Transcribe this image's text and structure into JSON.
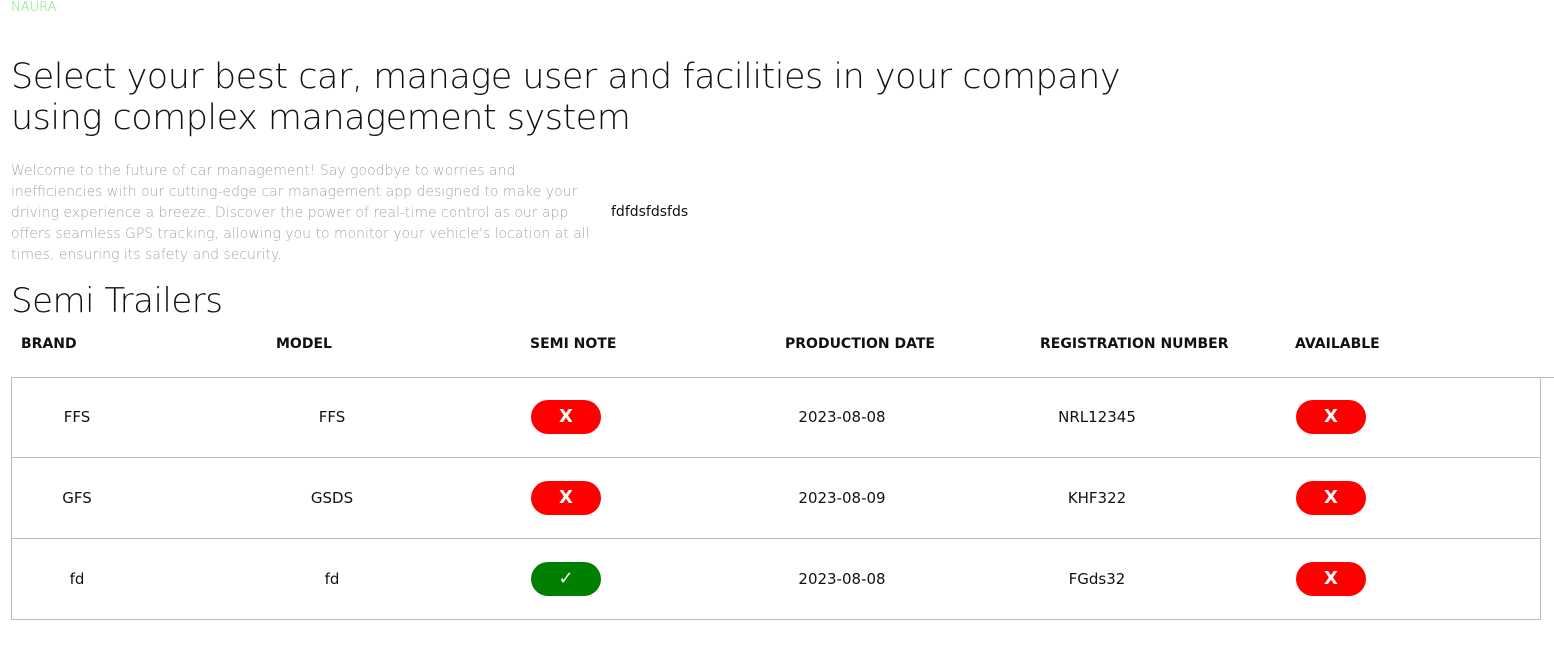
{
  "brand": "NAURA",
  "hero": {
    "title": "Select your best car, manage user and facilities in your company using complex management system",
    "description": "Welcome to the future of car management! Say goodbye to worries and inefficiencies with our cutting-edge car management app designed to make your driving experience a breeze. Discover the power of real-time control as our app offers seamless GPS tracking, allowing you to monitor your vehicle's location at all times, ensuring its safety and security.",
    "side_text": "fdfdsfdsfds"
  },
  "section": {
    "title": "Semi Trailers"
  },
  "table": {
    "headers": [
      "BRAND",
      "MODEL",
      "SEMI NOTE",
      "PRODUCTION DATE",
      "REGISTRATION NUMBER",
      "AVAILABLE"
    ],
    "rows": [
      {
        "brand": "FFS",
        "model": "FFS",
        "semi_note": "X",
        "semi_note_state": "no",
        "production_date": "2023-08-08",
        "registration_number": "NRL12345",
        "available": "X",
        "available_state": "no"
      },
      {
        "brand": "GFS",
        "model": "GSDS",
        "semi_note": "X",
        "semi_note_state": "no",
        "production_date": "2023-08-09",
        "registration_number": "KHF322",
        "available": "X",
        "available_state": "no"
      },
      {
        "brand": "fd",
        "model": "fd",
        "semi_note": "✓",
        "semi_note_state": "yes",
        "production_date": "2023-08-08",
        "registration_number": "FGds32",
        "available": "X",
        "available_state": "no"
      }
    ]
  },
  "colors": {
    "brand": "#7ee37e",
    "status_no": "#ff0000",
    "status_yes": "#008000",
    "border": "#bdbdbd",
    "muted_text": "#a8a8a8"
  }
}
